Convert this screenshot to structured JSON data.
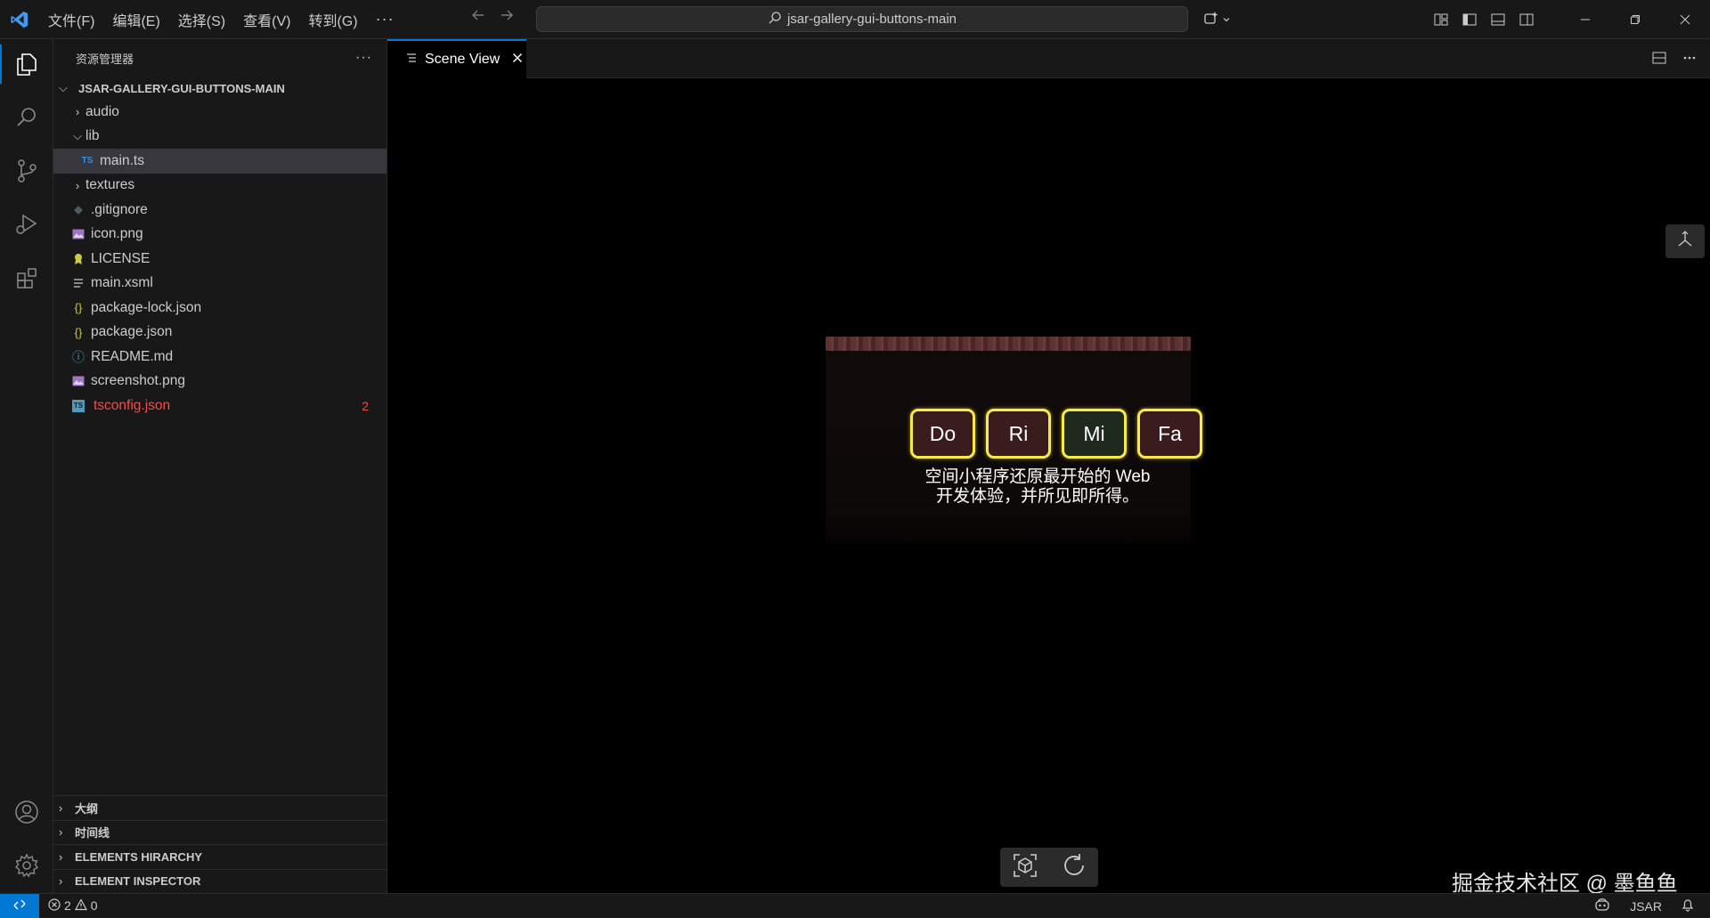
{
  "menu": [
    "文件(F)",
    "编辑(E)",
    "选择(S)",
    "查看(V)",
    "转到(G)",
    "···"
  ],
  "search": {
    "text": "jsar-gallery-gui-buttons-main"
  },
  "sidebar": {
    "title": "资源管理器",
    "more": "···",
    "root": "JSAR-GALLERY-GUI-BUTTONS-MAIN",
    "items": [
      {
        "label": "audio",
        "type": "folder",
        "open": false,
        "depth": 1
      },
      {
        "label": "lib",
        "type": "folder",
        "open": true,
        "depth": 1
      },
      {
        "label": "main.ts",
        "type": "ts",
        "depth": 2,
        "icon_text": "TS"
      },
      {
        "label": "textures",
        "type": "folder",
        "open": false,
        "depth": 1
      },
      {
        "label": ".gitignore",
        "type": "gitignore",
        "depth": 1
      },
      {
        "label": "icon.png",
        "type": "image",
        "depth": 1
      },
      {
        "label": "LICENSE",
        "type": "license",
        "depth": 1
      },
      {
        "label": "main.xsml",
        "type": "xsml",
        "depth": 1
      },
      {
        "label": "package-lock.json",
        "type": "json",
        "depth": 1,
        "icon_text": "{}"
      },
      {
        "label": "package.json",
        "type": "json",
        "depth": 1,
        "icon_text": "{}"
      },
      {
        "label": "README.md",
        "type": "info",
        "depth": 1,
        "icon_text": "ⓘ"
      },
      {
        "label": "screenshot.png",
        "type": "image",
        "depth": 1
      },
      {
        "label": "tsconfig.json",
        "type": "tsconfig",
        "depth": 1,
        "badge": "2",
        "icon_text": "TS"
      }
    ],
    "panes": [
      "大纲",
      "时间线",
      "ELEMENTS HIRARCHY",
      "ELEMENT INSPECTOR"
    ]
  },
  "tab": {
    "label": "Scene View"
  },
  "scene": {
    "notes": [
      "Do",
      "Ri",
      "Mi",
      "Fa"
    ],
    "caption_line1": "空间小程序还原最开始的 Web",
    "caption_line2": "开发体验，并所见即所得。"
  },
  "watermark": "掘金技术社区 @ 墨鱼鱼",
  "status": {
    "errors": "2",
    "warnings": "0",
    "language": "JSAR"
  },
  "colors": {
    "accent": "#0078d4",
    "note_border": "#f7e94a",
    "error": "#f14c4c"
  }
}
